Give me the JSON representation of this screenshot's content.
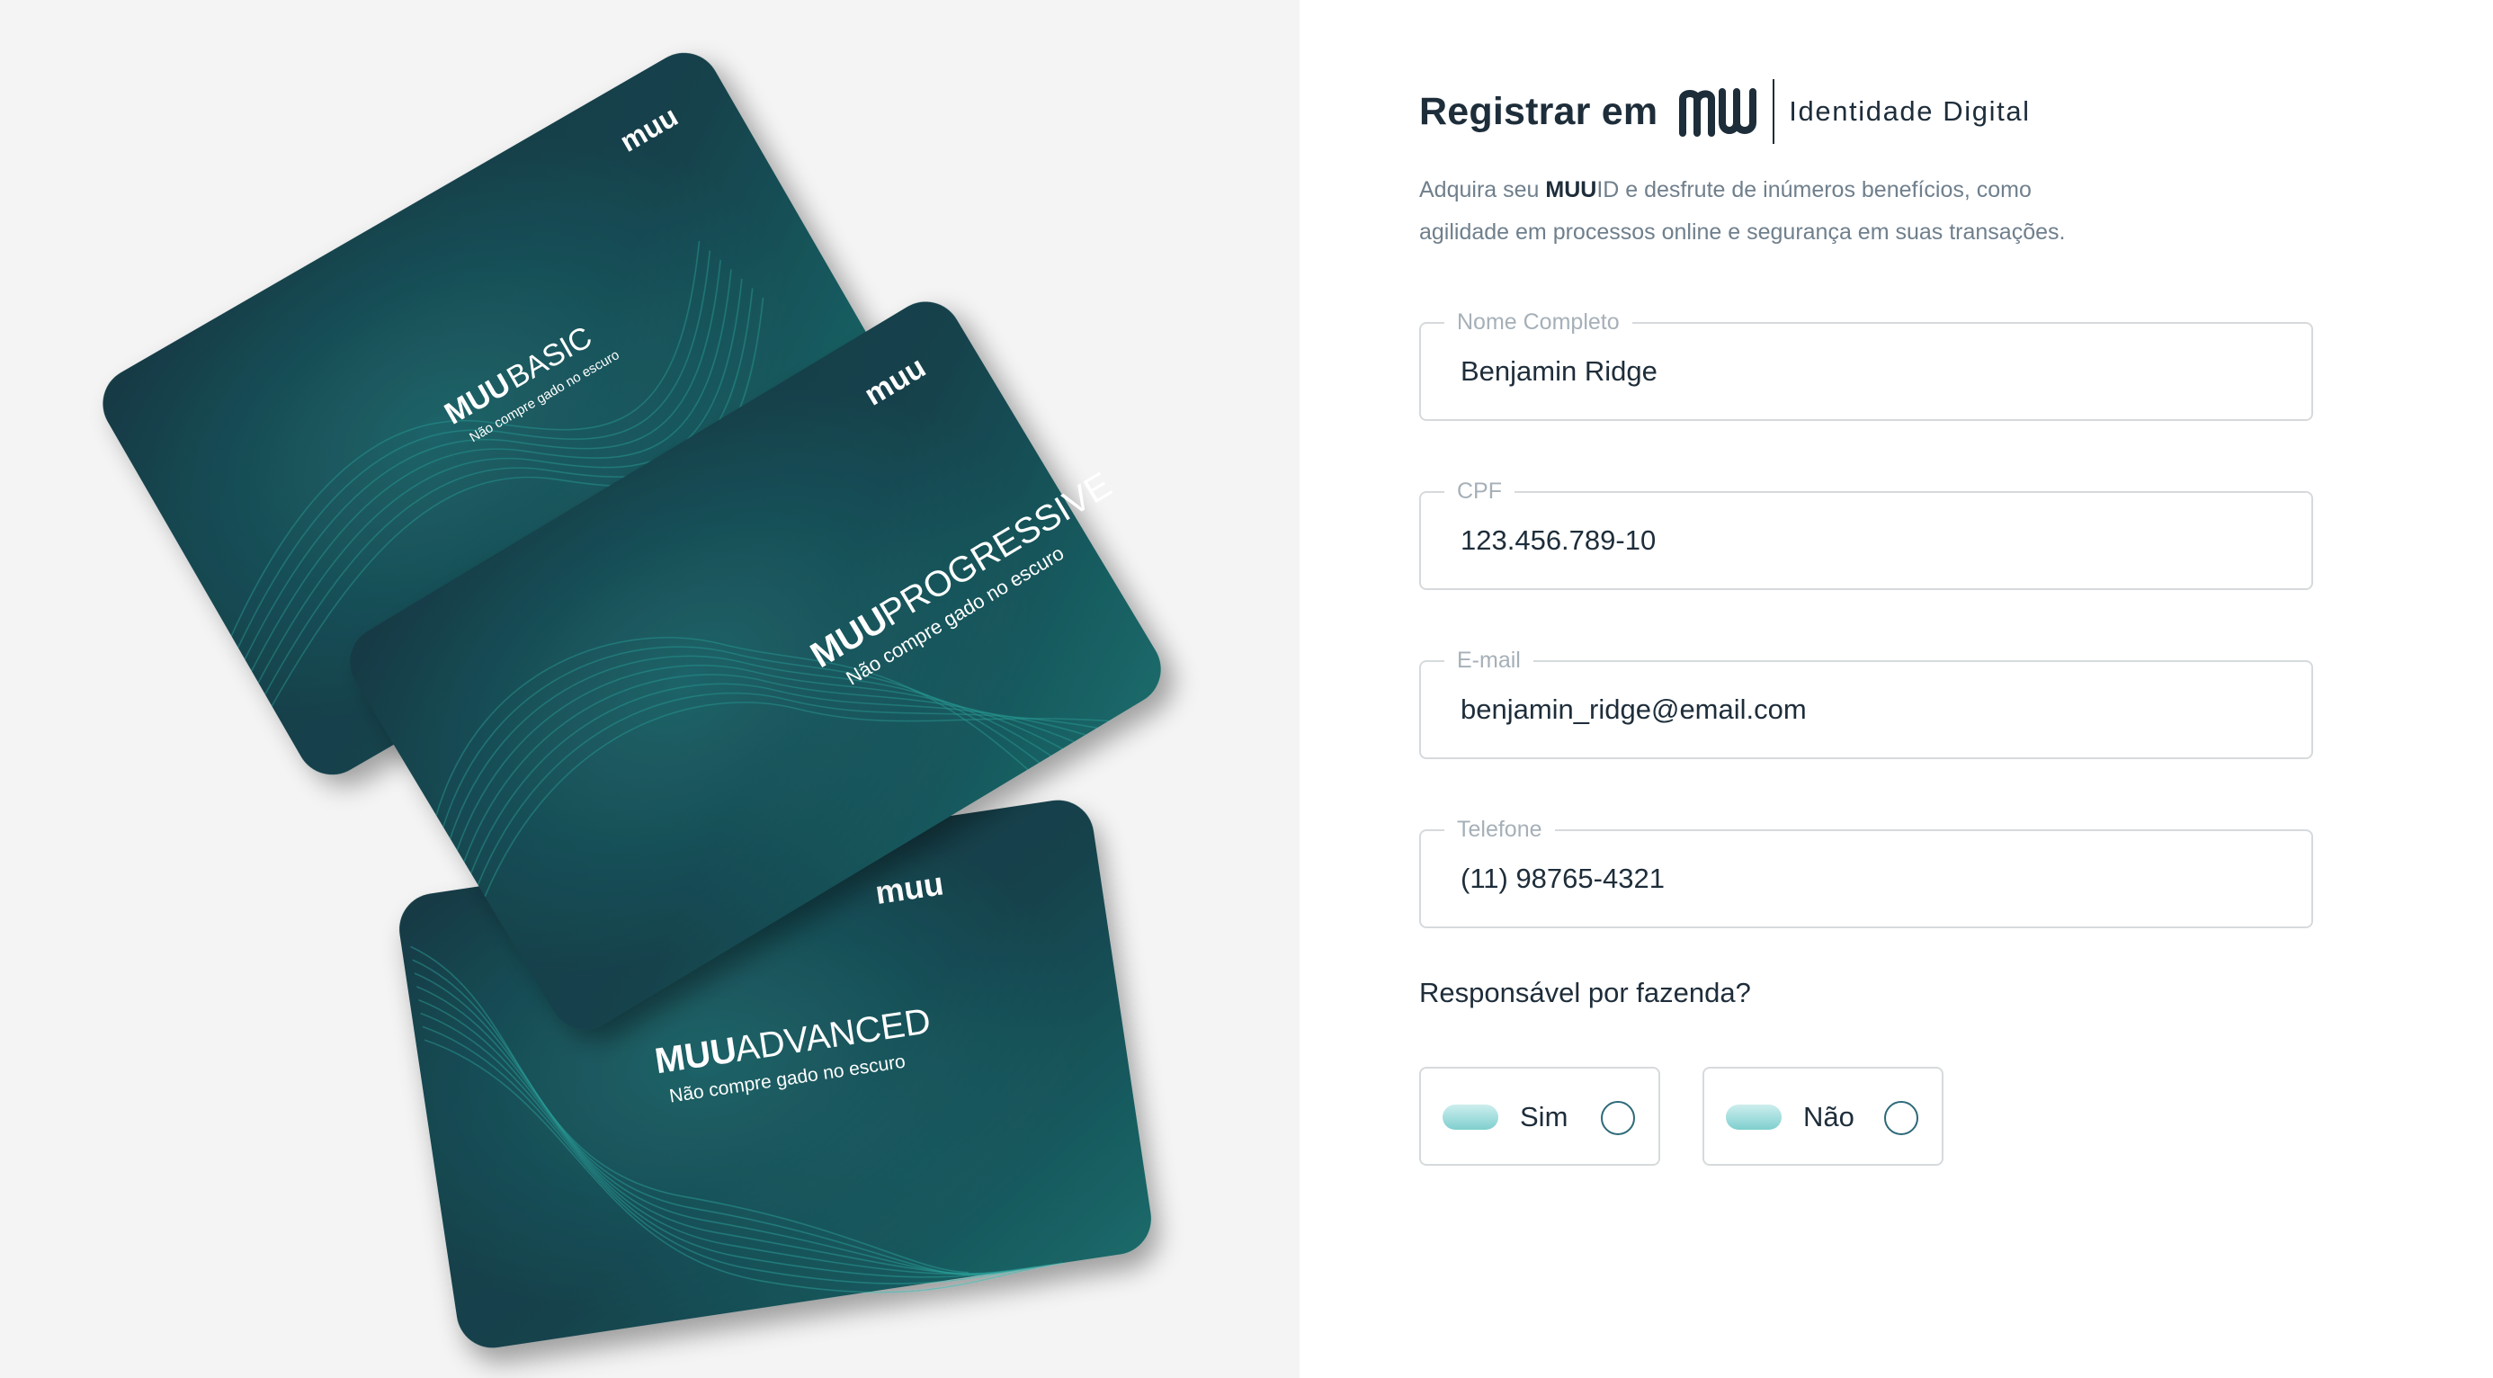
{
  "header": {
    "title": "Registrar em",
    "brand": "MUU",
    "tagline": "Identidade Digital"
  },
  "intro": {
    "line1_before": "Adquira  seu ",
    "line1_strong": "MUU",
    "line1_after": "ID e desfrute de inúmeros benefícios, como",
    "line2": "agilidade em processos online e segurança em suas transações."
  },
  "form": {
    "fields": [
      {
        "label": "Nome Completo",
        "value": "Benjamin Ridge"
      },
      {
        "label": "CPF",
        "value": "123.456.789-10"
      },
      {
        "label": "E-mail",
        "value": "benjamin_ridge@email.com"
      },
      {
        "label": "Telefone",
        "value": "(11) 98765-4321"
      }
    ],
    "question": "Responsável por fazenda?",
    "options": [
      {
        "label": "Sim",
        "selected": false
      },
      {
        "label": "Não",
        "selected": false
      }
    ]
  },
  "cards": [
    {
      "plan": "BASIC",
      "brand": "MUU",
      "slogan": "Não compre gado no escuro"
    },
    {
      "plan": "PROGRESSIVE",
      "brand": "MUU",
      "slogan": "Não compre gado no escuro"
    },
    {
      "plan": "ADVANCED",
      "brand": "MUU",
      "slogan": "Não compre gado no escuro"
    }
  ],
  "colors": {
    "card_dark": "#173a45",
    "card_teal": "#1a6a6a",
    "accent": "#2d6a78",
    "text_dark": "#1e2d3a",
    "text_muted": "#6f7f8c"
  }
}
